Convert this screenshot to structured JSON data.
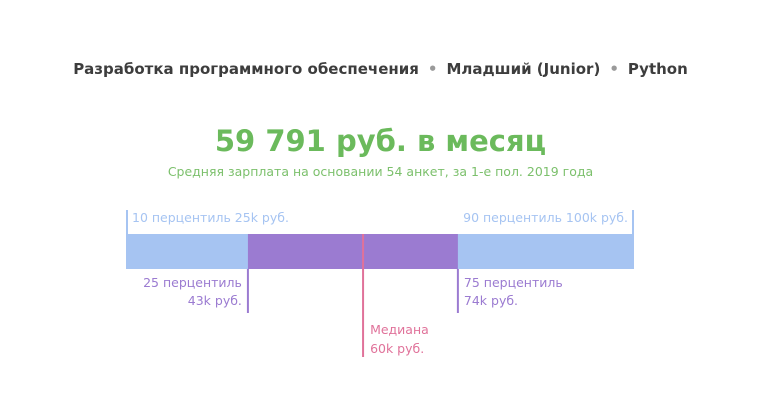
{
  "breadcrumb": {
    "items": [
      "Разработка программного обеспечения",
      "Младший (Junior)",
      "Python"
    ],
    "separator": "•"
  },
  "salary": {
    "main": "59 791 руб. в месяц",
    "subtitle": "Средняя зарплата на основании 54 анкет, за 1-е пол. 2019 года"
  },
  "colors": {
    "breadcrumb": "#3d3d3d",
    "accent_green": "#6bba5c",
    "outer_range": "#a6c4f2",
    "inner_range": "#9b7bd1",
    "median": "#e0729a"
  },
  "chart_data": {
    "type": "box",
    "unit": "k руб.",
    "p10": 25,
    "p25": 43,
    "median": 60,
    "p75": 74,
    "p90": 100,
    "labels": {
      "p10": {
        "line1": "10 перцентиль 25k руб."
      },
      "p90": {
        "line1": "90 перцентиль 100k руб."
      },
      "p25": {
        "line1": "25 перцентиль",
        "line2": "43k руб."
      },
      "p75": {
        "line1": "75 перцентиль",
        "line2": "74k руб."
      },
      "median": {
        "line1": "Медиана",
        "line2": "60k руб."
      }
    }
  }
}
